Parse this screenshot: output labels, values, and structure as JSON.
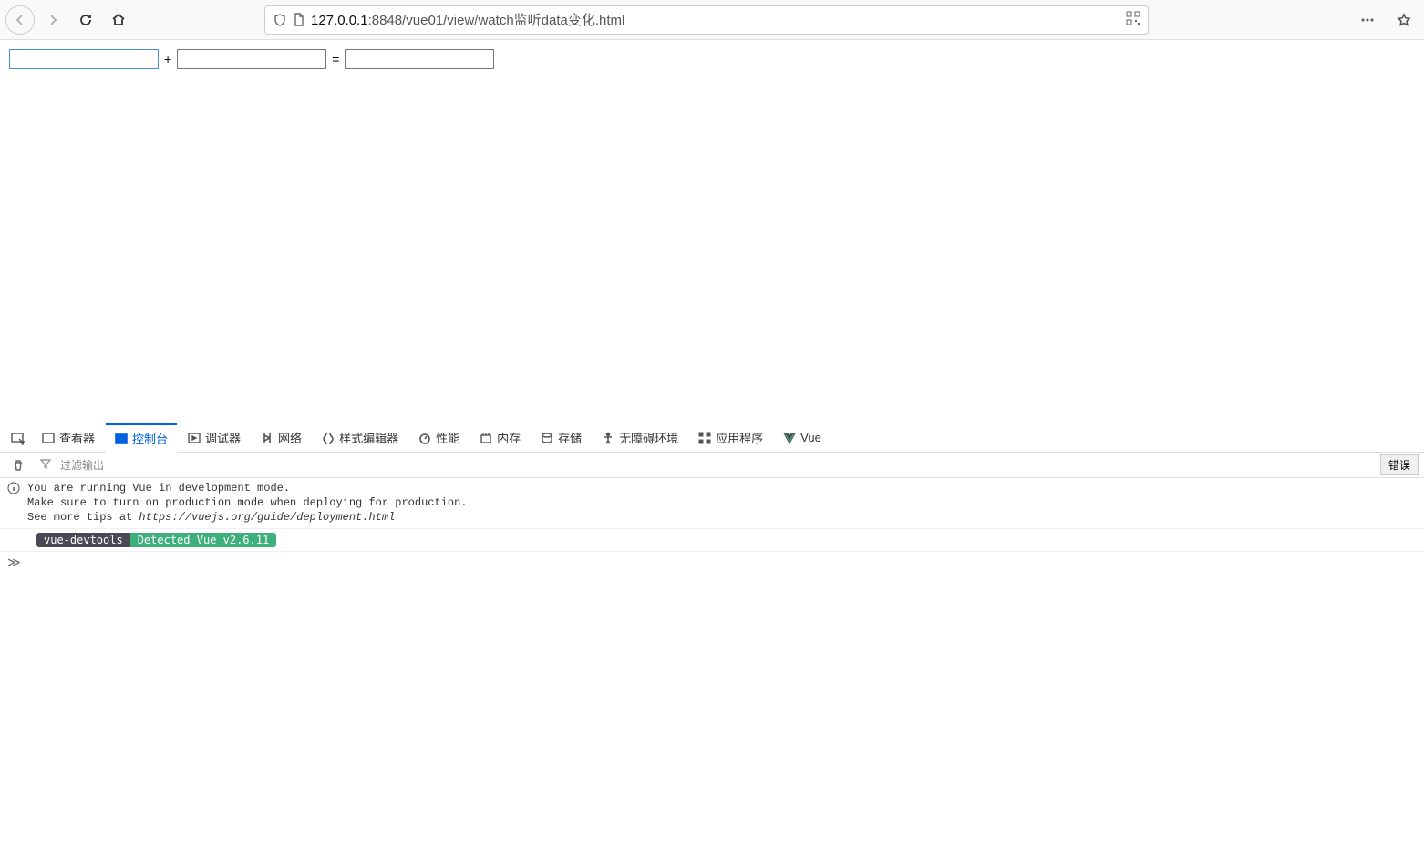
{
  "browser": {
    "url_prefix": "127.0.0.1",
    "url_suffix": ":8848/vue01/view/watch监听data变化.html"
  },
  "page": {
    "input1": "",
    "input2": "",
    "input3": "",
    "plus": "+",
    "equals": "="
  },
  "devtools": {
    "tabs": {
      "inspector": "查看器",
      "console": "控制台",
      "debugger": "调试器",
      "network": "网络",
      "style": "样式编辑器",
      "performance": "性能",
      "memory": "内存",
      "storage": "存储",
      "accessibility": "无障碍环境",
      "apps": "应用程序",
      "vue": "Vue"
    },
    "filter_placeholder": "过滤输出",
    "error_label": "错误",
    "console": {
      "line1": "You are running Vue in development mode.",
      "line2": "Make sure to turn on production mode when deploying for production.",
      "line3_a": "See more tips at ",
      "line3_b": "https://vuejs.org/guide/deployment.html",
      "badge1": "vue-devtools",
      "badge2": " Detected Vue v2.6.11 ",
      "prompt": "≫"
    }
  }
}
